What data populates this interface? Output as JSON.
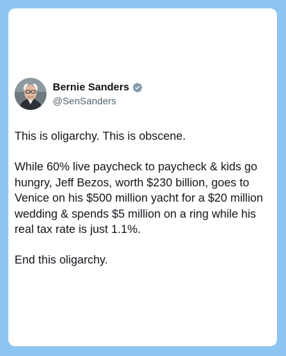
{
  "theme": {
    "background": "#8cc5f2",
    "card": "#ffffff",
    "text": "#0f1419",
    "secondary_text": "#536471",
    "verified_badge": "#829aab"
  },
  "author": {
    "display_name": "Bernie Sanders",
    "handle": "@SenSanders",
    "verified_icon": "verified-badge-icon",
    "avatar_icon": "profile-photo"
  },
  "tweet": {
    "paragraphs": [
      "This is oligarchy. This is obscene.",
      "While 60% live paycheck to paycheck & kids go hungry, Jeff Bezos, worth $230 billion, goes to Venice on his $500 million yacht for a $20 million wedding & spends $5 million on a ring while his real tax rate is just 1.1%.",
      "End this oligarchy."
    ]
  }
}
